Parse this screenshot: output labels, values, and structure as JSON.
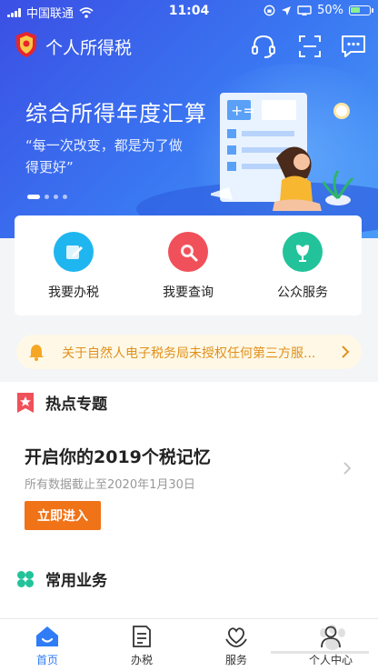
{
  "status_bar": {
    "carrier": "中国联通",
    "time": "11:04",
    "battery": "50%",
    "icons": [
      "signal-icon",
      "wifi-icon",
      "rotation-lock-icon",
      "location-icon",
      "screen-mirror-icon",
      "battery-icon"
    ]
  },
  "header": {
    "title": "个人所得税",
    "icons": [
      "headset-icon",
      "scan-icon",
      "message-icon"
    ]
  },
  "banner": {
    "title": "综合所得年度汇算",
    "subtitle": "“每一次改变，都是为了做得更好”",
    "slide_count": 4,
    "active_slide": 1
  },
  "quick_actions": [
    {
      "label": "我要办税",
      "icon": "pencil-icon",
      "color": "#1fb6f0"
    },
    {
      "label": "我要查询",
      "icon": "magnifier-icon",
      "color": "#f0505a"
    },
    {
      "label": "公众服务",
      "icon": "tulip-icon",
      "color": "#22c39a"
    }
  ],
  "notice": {
    "text": "关于自然人电子税务局未授权任何第三方服...",
    "icon": "bell-icon"
  },
  "hot_topics": {
    "heading": "热点专题",
    "card_title": "开启你的2019个税记忆",
    "card_subtitle": "所有数据截止至2020年1月30日",
    "button_label": "立即进入"
  },
  "common_services": {
    "heading": "常用业务"
  },
  "tabs": [
    {
      "label": "首页",
      "icon": "home-icon",
      "active": true
    },
    {
      "label": "办税",
      "icon": "document-icon",
      "active": false
    },
    {
      "label": "服务",
      "icon": "heart-hands-icon",
      "active": false
    },
    {
      "label": "个人中心",
      "icon": "person-icon",
      "active": false
    }
  ],
  "colors": {
    "primary": "#2f7cf6",
    "banner_start": "#3b4fe4",
    "banner_end": "#4a9bf8",
    "accent_orange": "#f07318",
    "notice_text": "#e0901c",
    "notice_bg": "#fff8e6"
  }
}
